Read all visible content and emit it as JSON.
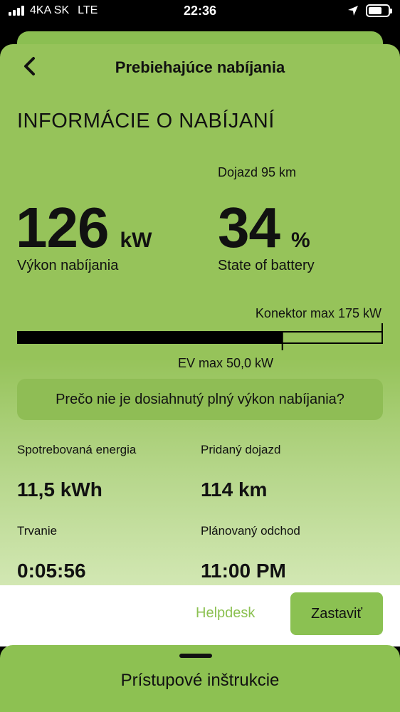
{
  "status_bar": {
    "carrier": "4KA SK",
    "network": "LTE",
    "time": "22:36",
    "battery_level": 0.7
  },
  "nav": {
    "title": "Prebiehajúce nabíjania"
  },
  "section_title": "INFORMÁCIE O NABÍJANÍ",
  "charging": {
    "power_value": "126",
    "power_unit": "kW",
    "power_caption": "Výkon nabíjania",
    "range_text": "Dojazd 95 km",
    "soc_value": "34",
    "soc_unit": "%",
    "soc_caption": "State of battery",
    "connector_max_label": "Konektor max 175 kW",
    "ev_max_label": "EV max 50,0 kW",
    "connector_max_kw": 175,
    "ev_max_kw": 50,
    "current_kw": 126
  },
  "why_button_label": "Prečo nie je dosiahnutý plný výkon nabíjania?",
  "stats": {
    "energy_label": "Spotrebovaná energia",
    "energy_value": "11,5 kWh",
    "added_range_label": "Pridaný dojazd",
    "added_range_value": "114 km",
    "duration_label": "Trvanie",
    "duration_value": "0:05:56",
    "departure_label": "Plánovaný odchod",
    "departure_value": "11:00 PM"
  },
  "actions": {
    "helpdesk_label": "Helpdesk",
    "stop_label": "Zastaviť"
  },
  "drawer": {
    "label": "Prístupové inštrukcie"
  },
  "colors": {
    "accent": "#8cc152",
    "sheet": "#96c35a"
  }
}
